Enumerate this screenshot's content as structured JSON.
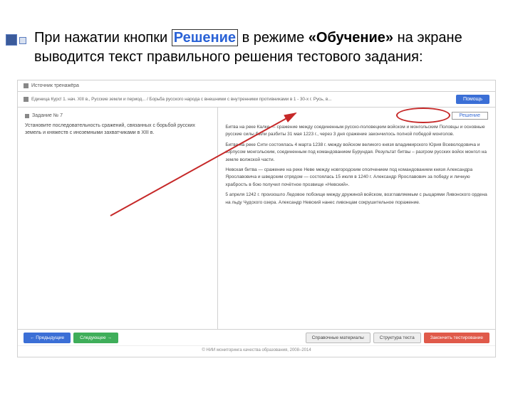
{
  "slide": {
    "pre": "При нажатии кнопки",
    "button_word": "Решение",
    "mid": "в режиме",
    "mode": "«Обучение»",
    "post": "на экране выводится текст правильного решения тестового задания:"
  },
  "toolbar1": {
    "label": "Источник тренажёра"
  },
  "toolbar2": {
    "crumb": "Единица Курс! 1. нач. XIII в., Русские земли и период... / Борьба русского народа с внешними с внутренними противниками в 1 - 30-х г. Русь, в...",
    "help_btn": "Помощь"
  },
  "task": {
    "number": "Задание № 7",
    "text": "Установите последовательность сражений, связанных с борьбой русских земель и княжеств с иноземными захватчиками в XIII в."
  },
  "solution": {
    "button": "Решение",
    "paras": [
      "Битва на реке Калке — сражение между соединенным русско-половецким войском и монгольским Половцы и основные русские силы были разбиты 31 мая 1223 г., через 3 дня сражение закончилось полной победой монголов.",
      "Битва на реке Сити состоялась 4 марта 1238 г. между войском великого князя владимирского Юрия Всеволодовича и корпусом монгольским, соединенным под командованием Бурундая. Результат битвы – разгром русских войск монгол на земле волжской части.",
      "Невская битва — сражение на реке Неве между новгородским ополчением под командованием князя Александра Ярославовича и шведским отрядом — состоялась 15 июля в 1240 г. Александр Ярославович за победу и личную храбрость в бою получил почётное прозвище «Невский».",
      "5 апреля 1242 г. произошло Ледовое побоище между дружиной войском, возглавляемым с рыцарями Ливонского ордена на льду Чудского озера. Александр Невский нанес ливонцам сокрушительное поражение."
    ]
  },
  "footer": {
    "prev": "← Предыдущие",
    "next": "Следующее →",
    "materials": "Справочные материалы",
    "task_struct": "Структура теста",
    "finish": "Закончить тестирование"
  },
  "copyright": "© НИИ мониторинга качества образования, 2008–2014"
}
